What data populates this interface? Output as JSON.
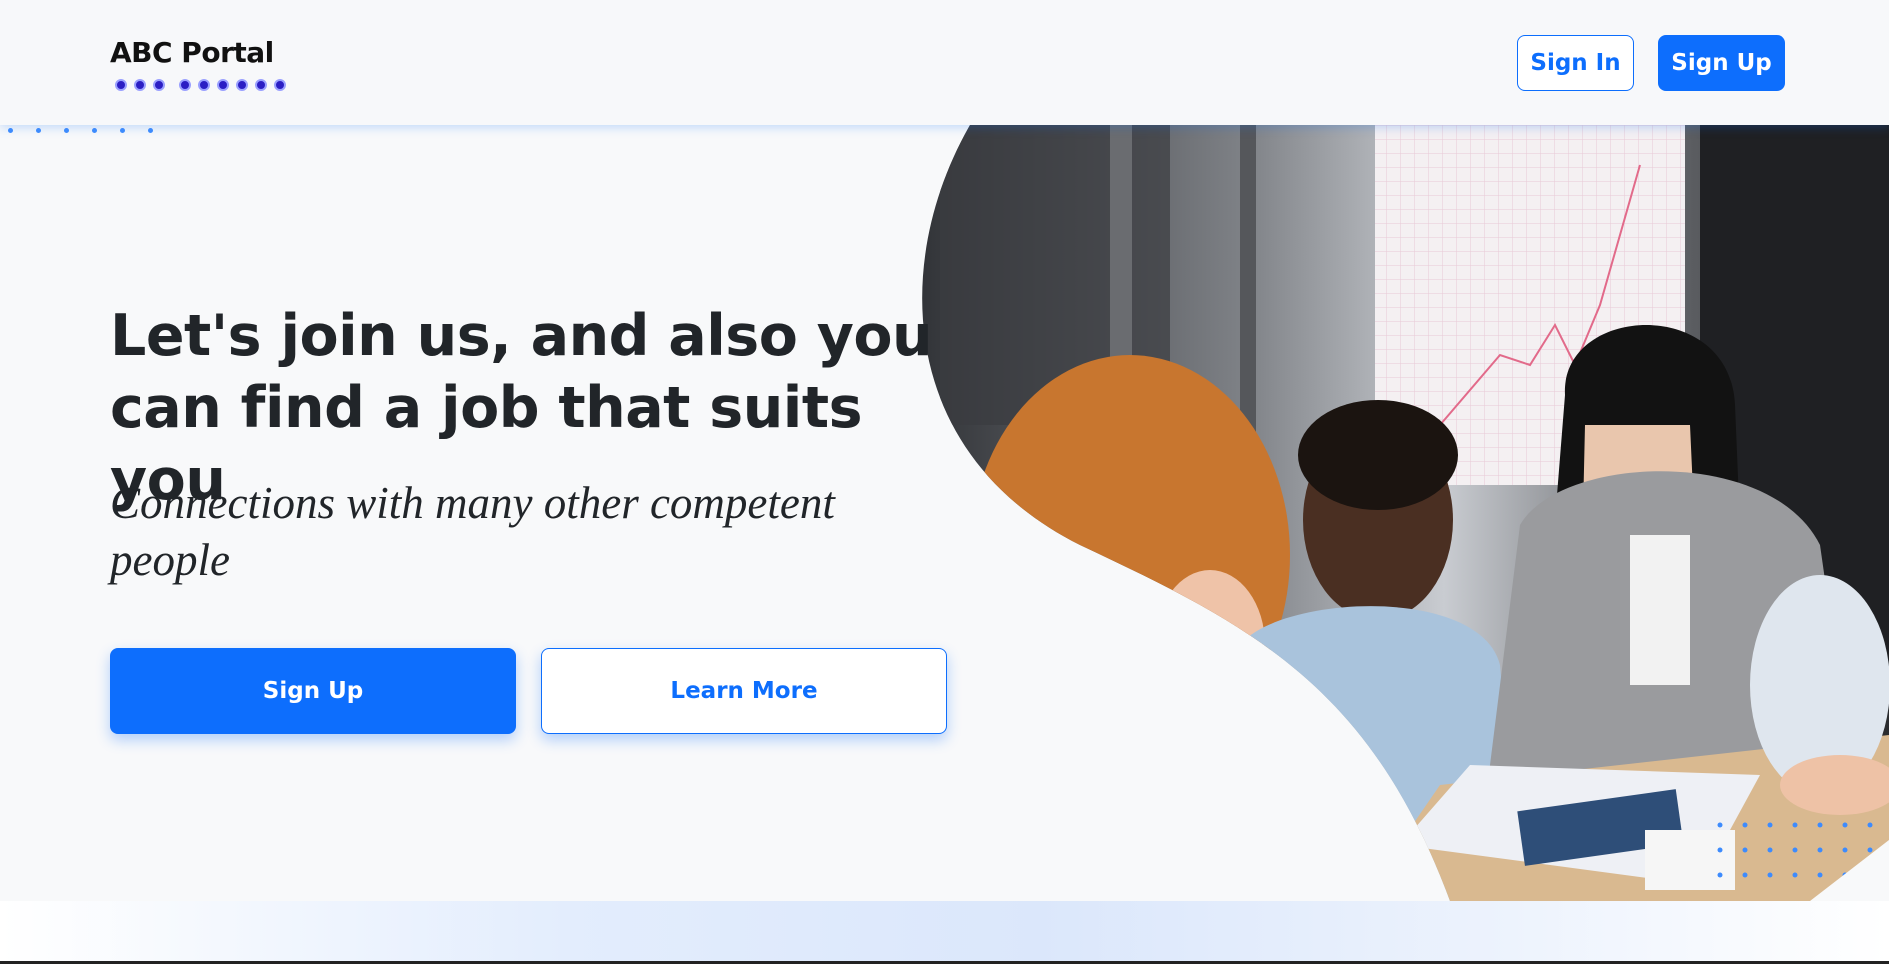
{
  "brand": {
    "name": "ABC Portal"
  },
  "nav": {
    "sign_in": "Sign In",
    "sign_up": "Sign Up"
  },
  "hero": {
    "title": "Let's join us, and also you can find a job that suits you",
    "subtitle": "Connections with many other competent people",
    "primary_cta": "Sign Up",
    "secondary_cta": "Learn More",
    "image": "team-meeting-photo"
  },
  "colors": {
    "primary": "#0d6efd",
    "text": "#212529",
    "background": "#f8f9fa"
  }
}
